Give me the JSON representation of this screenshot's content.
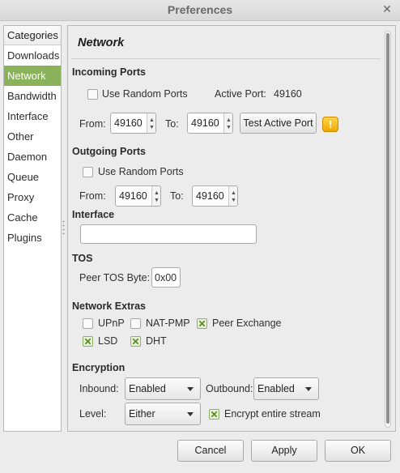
{
  "window": {
    "title": "Preferences",
    "close_glyph": "✕"
  },
  "sidebar": {
    "header": "Categories",
    "items": [
      {
        "label": "Downloads"
      },
      {
        "label": "Network"
      },
      {
        "label": "Bandwidth"
      },
      {
        "label": "Interface"
      },
      {
        "label": "Other"
      },
      {
        "label": "Daemon"
      },
      {
        "label": "Queue"
      },
      {
        "label": "Proxy"
      },
      {
        "label": "Cache"
      },
      {
        "label": "Plugins"
      }
    ],
    "selected": "Network"
  },
  "panel": {
    "title": "Network",
    "incoming": {
      "heading": "Incoming Ports",
      "random_label": "Use Random Ports",
      "random_checked": false,
      "active_port_label": "Active Port:",
      "active_port_value": "49160",
      "from_label": "From:",
      "from_value": "49160",
      "to_label": "To:",
      "to_value": "49160",
      "test_button": "Test Active Port",
      "warning_glyph": "!"
    },
    "outgoing": {
      "heading": "Outgoing Ports",
      "random_label": "Use Random Ports",
      "random_checked": false,
      "from_label": "From:",
      "from_value": "49160",
      "to_label": "To:",
      "to_value": "49160"
    },
    "interface": {
      "heading": "Interface",
      "value": ""
    },
    "tos": {
      "heading": "TOS",
      "label": "Peer TOS Byte:",
      "value": "0x00"
    },
    "extras": {
      "heading": "Network Extras",
      "upnp": {
        "label": "UPnP",
        "checked": false
      },
      "natpmp": {
        "label": "NAT-PMP",
        "checked": false
      },
      "pex": {
        "label": "Peer Exchange",
        "checked": true
      },
      "lsd": {
        "label": "LSD",
        "checked": true
      },
      "dht": {
        "label": "DHT",
        "checked": true
      }
    },
    "encryption": {
      "heading": "Encryption",
      "inbound_label": "Inbound:",
      "inbound_value": "Enabled",
      "outbound_label": "Outbound:",
      "outbound_value": "Enabled",
      "level_label": "Level:",
      "level_value": "Either",
      "encrypt_stream_label": "Encrypt entire stream",
      "encrypt_stream_checked": true
    }
  },
  "footer": {
    "cancel": "Cancel",
    "apply": "Apply",
    "ok": "OK"
  },
  "colors": {
    "selection": "#8ab25a",
    "warning": "#f0a800"
  }
}
